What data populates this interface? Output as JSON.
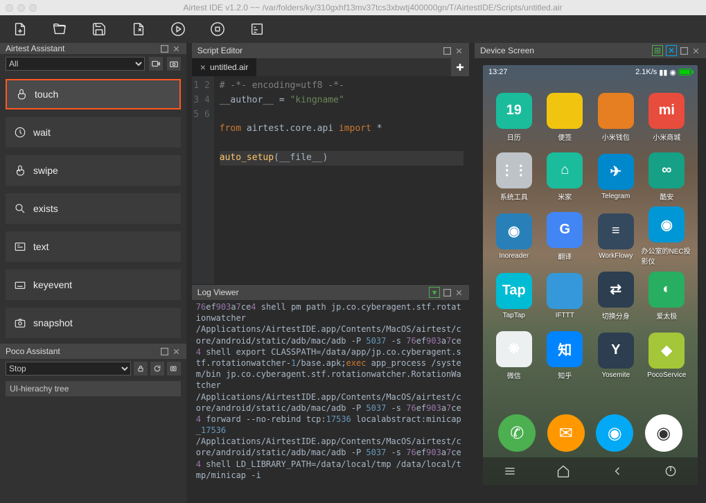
{
  "window": {
    "title": "Airtest IDE v1.2.0 ~~ /var/folders/ky/310gxhf13mv37tcs3xbwtj400000gn/T/AirtestIDE/Scripts/untitled.air"
  },
  "panels": {
    "assistant": "Airtest Assistant",
    "scriptEditor": "Script Editor",
    "logViewer": "Log Viewer",
    "deviceScreen": "Device Screen",
    "poco": "Poco Assistant"
  },
  "assistant": {
    "filter": "All",
    "items": [
      {
        "label": "touch",
        "highlighted": true,
        "icon": "tap"
      },
      {
        "label": "wait",
        "highlighted": false,
        "icon": "clock"
      },
      {
        "label": "swipe",
        "highlighted": false,
        "icon": "swipe"
      },
      {
        "label": "exists",
        "highlighted": false,
        "icon": "search"
      },
      {
        "label": "text",
        "highlighted": false,
        "icon": "text"
      },
      {
        "label": "keyevent",
        "highlighted": false,
        "icon": "keyboard"
      },
      {
        "label": "snapshot",
        "highlighted": false,
        "icon": "camera"
      }
    ]
  },
  "poco": {
    "mode": "Stop",
    "tree": "UI-hierachy tree"
  },
  "editor": {
    "tab": "untitled.air",
    "lines": [
      {
        "n": "1",
        "html": "<span class='com'># -*- encoding=utf8 -*-</span>"
      },
      {
        "n": "2",
        "html": "__author__ = <span class='str'>\"kingname\"</span>"
      },
      {
        "n": "3",
        "html": ""
      },
      {
        "n": "4",
        "html": "<span class='kw'>from</span> airtest.core.api <span class='kw'>import</span> *"
      },
      {
        "n": "5",
        "html": ""
      },
      {
        "n": "6",
        "html": "<span class='fn'>auto_setup</span>(__file__)",
        "active": true
      }
    ]
  },
  "log": {
    "html": "<span class='hash'>76</span>ef<span class='hash'>903</span>a<span class='hash'>7</span>ce<span class='hash'>4</span> shell pm path jp.co.cyberagent.stf.rotationwatcher\n/Applications/AirtestIDE.app/Contents/MacOS/airtest/core/android/static/adb/mac/adb -P <span class='num'>5037</span> -s <span class='hash'>76</span>ef<span class='hash'>903</span>a<span class='hash'>7</span>ce<span class='hash'>4</span> shell export CLASSPATH=/data/app/jp.co.cyberagent.stf.rotationwatcher-<span class='num'>1</span>/base.apk;<span class='ex'>exec</span> app_process /system/bin jp.co.cyberagent.stf.rotationwatcher.RotationWatcher\n/Applications/AirtestIDE.app/Contents/MacOS/airtest/core/android/static/adb/mac/adb -P <span class='num'>5037</span> -s <span class='hash'>76</span>ef<span class='hash'>903</span>a<span class='hash'>7</span>ce<span class='hash'>4</span> forward --no-rebind tcp:<span class='num'>17536</span> localabstract:minicap_<span class='num'>17536</span>\n/Applications/AirtestIDE.app/Contents/MacOS/airtest/core/android/static/adb/mac/adb -P <span class='num'>5037</span> -s <span class='hash'>76</span>ef<span class='hash'>903</span>a<span class='hash'>7</span>ce<span class='hash'>4</span> shell LD_LIBRARY_PATH=/data/local/tmp /data/local/tmp/minicap -i"
  },
  "phone": {
    "time": "13:27",
    "speed": "2.1K/s",
    "apps": [
      {
        "label": "日历",
        "text": "19",
        "bg": "#1abc9c"
      },
      {
        "label": "便签",
        "text": "",
        "bg": "#f1c40f"
      },
      {
        "label": "小米钱包",
        "text": "",
        "bg": "#e67e22"
      },
      {
        "label": "小米商城",
        "text": "mi",
        "bg": "#e74c3c"
      },
      {
        "label": "系统工具",
        "text": "⋮⋮",
        "bg": "#bdc3c7"
      },
      {
        "label": "米家",
        "text": "⌂",
        "bg": "#1abc9c"
      },
      {
        "label": "Telegram",
        "text": "✈",
        "bg": "#0088cc"
      },
      {
        "label": "酷安",
        "text": "∞",
        "bg": "#16a085"
      },
      {
        "label": "Inoreader",
        "text": "◉",
        "bg": "#2980b9"
      },
      {
        "label": "翻译",
        "text": "G",
        "bg": "#4285f4"
      },
      {
        "label": "WorkFlowy",
        "text": "≡",
        "bg": "#34495e"
      },
      {
        "label": "办公室的NEC投影仪",
        "text": "◉",
        "bg": "#0097d6"
      },
      {
        "label": "TapTap",
        "text": "Tap",
        "bg": "#00bcd4"
      },
      {
        "label": "IFTTT",
        "text": "",
        "bg": "#3498db"
      },
      {
        "label": "切换分身",
        "text": "⇄",
        "bg": "#2c3e50"
      },
      {
        "label": "爱太极",
        "text": "◐",
        "bg": "#27ae60"
      },
      {
        "label": "微信",
        "text": "❋",
        "bg": "#ecf0f1"
      },
      {
        "label": "知乎",
        "text": "知",
        "bg": "#0084ff"
      },
      {
        "label": "Yosemite",
        "text": "Y",
        "bg": "#2c3e50"
      },
      {
        "label": "PocoService",
        "text": "◆",
        "bg": "#a4c639"
      }
    ],
    "dock": [
      {
        "bg": "#4caf50",
        "icon": "phone"
      },
      {
        "bg": "#ff9800",
        "icon": "msg"
      },
      {
        "bg": "#03a9f4",
        "icon": "browser"
      },
      {
        "bg": "#ffffff",
        "icon": "camera"
      }
    ]
  }
}
